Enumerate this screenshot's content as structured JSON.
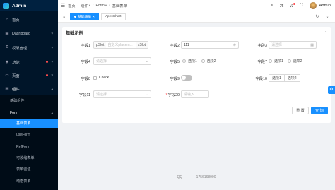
{
  "app": {
    "name": "Admin"
  },
  "sidebar": {
    "items": [
      {
        "label": "首页",
        "icon": "home-icon"
      },
      {
        "label": "Dashboard",
        "icon": "dashboard-icon",
        "arrow": "▾"
      },
      {
        "label": "权限管理",
        "icon": "lock-icon",
        "arrow": "▾"
      },
      {
        "label": "功能",
        "icon": "function-icon",
        "arrow": "▾",
        "dot": true
      },
      {
        "label": "页面",
        "icon": "page-icon",
        "arrow": "▾",
        "dot": true
      },
      {
        "label": "组件",
        "icon": "component-icon",
        "arrow": "▴"
      }
    ],
    "sub": [
      {
        "label": "基础组件",
        "arrow": "▾"
      },
      {
        "label": "Form",
        "arrow": "▴"
      },
      {
        "label": "基础表单",
        "active": true
      },
      {
        "label": "useForm"
      },
      {
        "label": "RefForm"
      },
      {
        "label": "可收缩表单"
      },
      {
        "label": "表单验证"
      },
      {
        "label": "动态表单"
      }
    ]
  },
  "header": {
    "breadcrumb": [
      "首页",
      "组件",
      "Form",
      "基础表单"
    ],
    "username": "Admin"
  },
  "tabs": [
    {
      "label": "基础表单",
      "active": true
    },
    {
      "label": "ApexChart",
      "active": false
    }
  ],
  "card": {
    "title": "基础示例",
    "fields": {
      "f1": {
        "label": "字段1",
        "placeholder": "自定义placem...",
        "prefix": "pSlot",
        "suffix": "sSlot"
      },
      "f2": {
        "label": "字段2",
        "value": "111"
      },
      "f3": {
        "label": "字段3",
        "placeholder": "请选择"
      },
      "f4": {
        "label": "字段4",
        "placeholder": "请选择"
      },
      "f5": {
        "label": "字段5",
        "options": [
          "选项1",
          "选项2"
        ]
      },
      "f7": {
        "label": "字段7",
        "options": [
          "选项1",
          "选项2"
        ]
      },
      "f8": {
        "label": "字段8",
        "text": "Check"
      },
      "f9": {
        "label": "字段9"
      },
      "f10": {
        "label": "字段10",
        "options": [
          "选项1",
          "选项2"
        ]
      },
      "f11": {
        "label": "字段11",
        "placeholder": "请选择"
      },
      "f20": {
        "label": "字段20",
        "placeholder": "请输入"
      }
    },
    "reset_label": "重 置",
    "search_label": "查 询"
  },
  "footer": {
    "left": "QQ",
    "right": "1756168900"
  },
  "colors": {
    "primary": "#1890ff",
    "sidebar": "#001529",
    "danger": "#ff4d4f"
  }
}
